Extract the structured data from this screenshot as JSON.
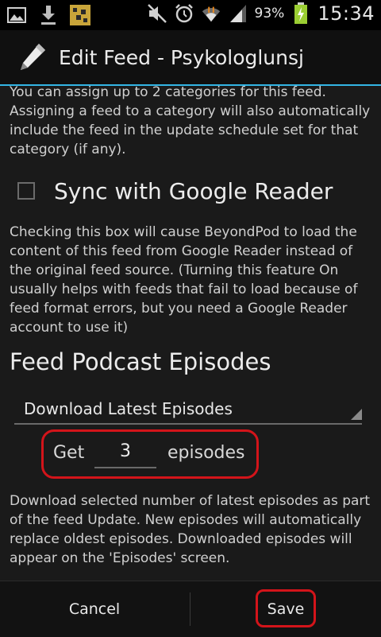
{
  "status_bar": {
    "battery_percent": "93%",
    "time": "15:34",
    "left_icons": [
      "image-icon",
      "download-icon",
      "app-icon"
    ],
    "right_icons": [
      "mute-icon",
      "alarm-icon",
      "wifi-icon",
      "signal-icon",
      "battery-icon"
    ]
  },
  "action_bar": {
    "title": "Edit Feed - Psykologlunsj",
    "icon": "pencil-icon"
  },
  "categories": {
    "description": "You can assign up to 2 categories for this feed. Assigning a feed to a category will also automatically include the feed in the update schedule set for that category (if any)."
  },
  "sync": {
    "label": "Sync with Google Reader",
    "checked": false,
    "description": "Checking this box will cause BeyondPod to load the content of this feed from Google Reader instead of the original feed source. (Turning this feature On usually helps with feeds that fail to load because of feed format errors, but you need a Google Reader account to use it)"
  },
  "podcast": {
    "section_title": "Feed Podcast Episodes",
    "mode_value": "Download Latest Episodes",
    "get_label": "Get",
    "count_value": "3",
    "unit_label": "episodes",
    "description": "Download selected number of latest episodes as part of the feed Update. New episodes will automatically replace oldest episodes. Downloaded episodes will appear on the 'Episodes' screen."
  },
  "buttons": {
    "cancel": "Cancel",
    "save": "Save"
  },
  "colors": {
    "accent": "#33b5e5",
    "highlight": "#d3141a",
    "background": "#1a1a1a"
  }
}
